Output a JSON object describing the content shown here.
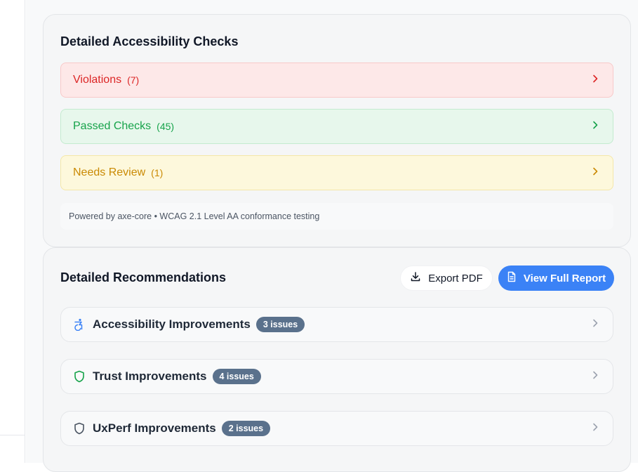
{
  "checks": {
    "title": "Detailed Accessibility Checks",
    "rows": [
      {
        "label": "Violations",
        "count": "(7)"
      },
      {
        "label": "Passed Checks",
        "count": "(45)"
      },
      {
        "label": "Needs Review",
        "count": "(1)"
      }
    ],
    "footer": "Powered by axe-core • WCAG 2.1 Level AA conformance testing"
  },
  "recommendations": {
    "title": "Detailed Recommendations",
    "export_label": "Export PDF",
    "report_label": "View Full Report",
    "items": [
      {
        "label": "Accessibility Improvements",
        "badge": "3 issues",
        "icon": "accessibility-icon"
      },
      {
        "label": "Trust Improvements",
        "badge": "4 issues",
        "icon": "shield-icon"
      },
      {
        "label": "UxPerf Improvements",
        "badge": "2 issues",
        "icon": "shield-icon"
      }
    ]
  },
  "colors": {
    "violations": "#dc2626",
    "passed": "#16a34a",
    "review": "#ca8a04",
    "primary": "#3b82f6",
    "badge": "#5a718c"
  }
}
